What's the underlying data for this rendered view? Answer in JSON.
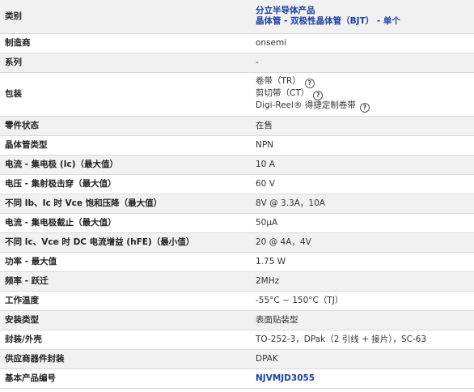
{
  "rows": [
    {
      "label": "类别",
      "values": [
        "分立半导体产品",
        "晶体管 - 双极性晶体管（BJT） - 单个"
      ]
    },
    {
      "label": "制造商",
      "value": "onsemi"
    },
    {
      "label": "系列",
      "value": "-"
    },
    {
      "label": "包装",
      "packaging": [
        {
          "text": "卷带（TR）",
          "icon": "help-circle-icon"
        },
        {
          "text": "剪切带（CT）",
          "icon": "help-circle-icon"
        },
        {
          "text": "Digi-Reel® 得捷定制卷带",
          "icon": "help-circle-icon"
        }
      ]
    },
    {
      "label": "零件状态",
      "value": "在售"
    },
    {
      "label": "晶体管类型",
      "value": "NPN"
    },
    {
      "label": "电流 - 集电极 (Ic)（最大值）",
      "value": "10 A"
    },
    {
      "label": "电压 - 集射极击穿（最大值）",
      "value": "60 V"
    },
    {
      "label": "不同 Ib、Ic 时 Vce 饱和压降（最大值）",
      "value": "8V @ 3.3A，10A"
    },
    {
      "label": "电流 - 集电极截止（最大值）",
      "value": "50µA"
    },
    {
      "label": "不同 Ic、Vce 时 DC 电流增益 (hFE)（最小值）",
      "value": "20 @ 4A，4V"
    },
    {
      "label": "功率 - 最大值",
      "value": "1.75 W"
    },
    {
      "label": "频率 - 跃迁",
      "value": "2MHz"
    },
    {
      "label": "工作温度",
      "value": "-55°C ~ 150°C（TJ）"
    },
    {
      "label": "安装类型",
      "value": "表面贴装型"
    },
    {
      "label": "封装/外壳",
      "value": "TO-252-3，DPak（2 引线 + 接片），SC-63"
    },
    {
      "label": "供应商器件封装",
      "value": "DPAK"
    },
    {
      "label": "基本产品编号",
      "value": "NJVMJD3055"
    }
  ],
  "colors": {
    "link": "#1a3fa3",
    "row_alt": "#f1f1f1",
    "border": "#d9d9d9"
  }
}
